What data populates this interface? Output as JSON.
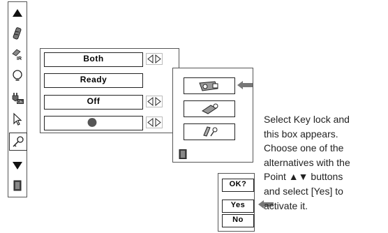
{
  "menu": {
    "icons": [
      "up-triangle-icon",
      "wrench-icon",
      "ir-remote-icon",
      "lamp-icon",
      "power-plug-on-icon",
      "pointer-icon",
      "key-icon",
      "down-triangle-icon",
      "exit-icon"
    ],
    "selected_icon": "key-icon"
  },
  "settings": {
    "fields": [
      {
        "value": "Both",
        "has_arrows": true
      },
      {
        "value": "Ready",
        "has_arrows": false
      },
      {
        "value": "Off",
        "has_arrows": true
      },
      {
        "value": "",
        "has_arrows": true,
        "icon": "circle-indicator-icon"
      }
    ]
  },
  "key_lock_dialog": {
    "options": [
      "projector-lock-icon",
      "remote-lock-icon",
      "unlock-icon"
    ],
    "exit_icon": "exit-icon"
  },
  "confirm_dialog": {
    "question": "OK?",
    "yes": "Yes",
    "no": "No"
  },
  "description": {
    "lines": [
      "Select Key lock and",
      "this box appears.",
      "Choose one of the",
      "alternatives with the",
      "Point ▲▼ buttons",
      "and select [Yes] to",
      "activate it."
    ]
  }
}
